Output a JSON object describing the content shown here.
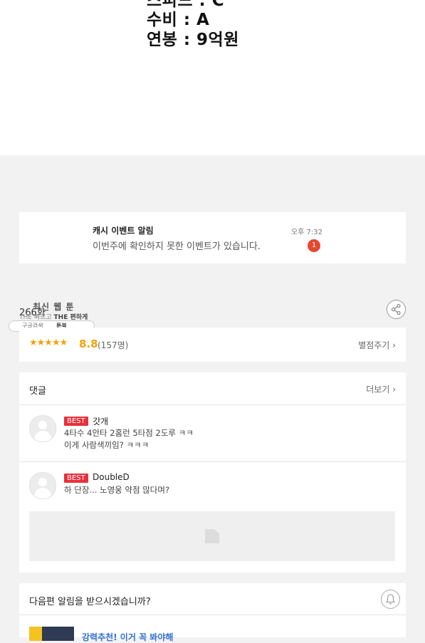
{
  "stats": [
    "스피드 : C",
    "수비 : A",
    "연봉 : 9억원"
  ],
  "notification": {
    "title": "캐시 이벤트 알림",
    "message": "이번주에 확인하지 못한 이벤트가 있습니다.",
    "time": "오후 7:32",
    "badge": "1"
  },
  "info": {
    "count": "266화",
    "watermark_title": "최신 웹 툰",
    "watermark_line_a": "THE 빠르고",
    "watermark_line_b": "THE 편하게",
    "watermark_search": "구글검색",
    "watermark_site": "툰북"
  },
  "rating": {
    "stars": "★★★★★",
    "score": "8.8",
    "votes": "(157명)",
    "rate_label": "별점주기"
  },
  "comments": {
    "title": "댓글",
    "more_label": "더보기",
    "items": [
      {
        "badge": "BEST",
        "author": "갓개",
        "lines": [
          "4타수 4안타 2홈런 5타점 2도루 ㅋㅋ",
          "이게 사람색끼임? ㅋㅋㅋ"
        ]
      },
      {
        "badge": "BEST",
        "author": "DoubleD",
        "lines": [
          "하 단장... 노영웅 약점 많다며?",
          ""
        ]
      }
    ]
  },
  "alert": {
    "title": "다음편 알림을 받으시겠습니까?",
    "next_title": "강력추천! 이거 꼭 봐야해"
  },
  "colors": {
    "accent_star": "#f2a20c",
    "best_badge": "#e8303b",
    "notif_badge": "#e8472f",
    "link_blue": "#2f6fd6"
  }
}
